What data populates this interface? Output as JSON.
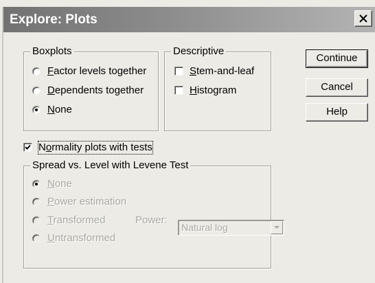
{
  "window": {
    "title": "Explore: Plots"
  },
  "icons": {
    "close": "close-icon",
    "check": "checkmark-icon",
    "dropdown": "chevron-down-icon"
  },
  "boxplots": {
    "legend": "Boxplots",
    "options": [
      {
        "label": "Factor levels together",
        "checked": false
      },
      {
        "label": "Dependents together",
        "checked": false
      },
      {
        "label": "None",
        "checked": true
      }
    ]
  },
  "descriptive": {
    "legend": "Descriptive",
    "options": [
      {
        "label": "Stem-and-leaf",
        "checked": false
      },
      {
        "label": "Histogram",
        "checked": false
      }
    ]
  },
  "buttons": {
    "continue": "Continue",
    "cancel": "Cancel",
    "help": "Help"
  },
  "normality": {
    "label": "Normality plots with tests",
    "checked": true
  },
  "spread": {
    "legend": "Spread vs. Level with Levene Test",
    "enabled": false,
    "options": [
      {
        "label": "None",
        "checked": true
      },
      {
        "label": "Power estimation",
        "checked": false
      },
      {
        "label": "Transformed",
        "checked": false
      },
      {
        "label": "Untransformed",
        "checked": false
      }
    ],
    "power_label": "Power:",
    "power_value": "Natural log"
  }
}
